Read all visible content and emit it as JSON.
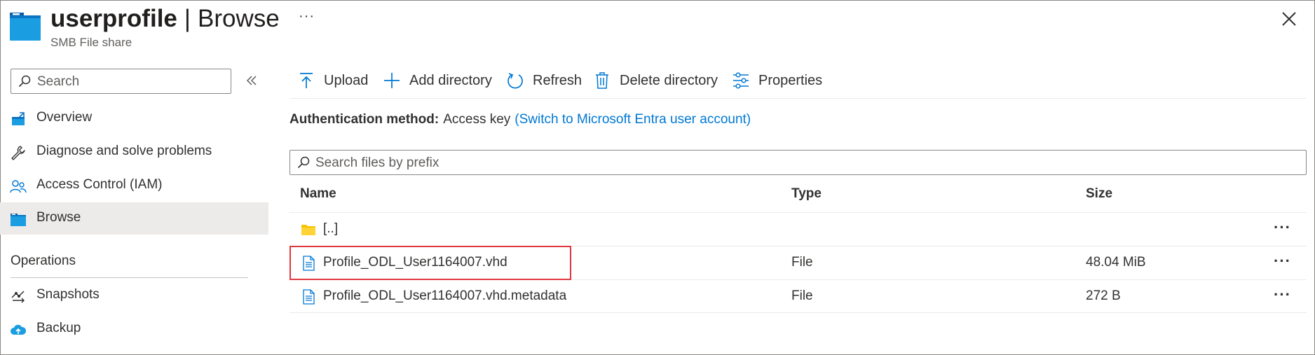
{
  "header": {
    "title_bold": "userprofile",
    "separator": "|",
    "title_rest": "Browse",
    "subtitle": "SMB File share",
    "more": "···",
    "icons": {
      "resource": "file-share-icon",
      "close": "close-icon"
    }
  },
  "sidebar": {
    "search_placeholder": "Search",
    "items": [
      {
        "label": "Overview",
        "icon": "overview-icon"
      },
      {
        "label": "Diagnose and solve problems",
        "icon": "wrench-icon"
      },
      {
        "label": "Access Control (IAM)",
        "icon": "people-icon"
      },
      {
        "label": "Browse",
        "icon": "file-share-icon",
        "active": true
      }
    ],
    "section": "Operations",
    "section_items": [
      {
        "label": "Snapshots",
        "icon": "snapshots-icon"
      },
      {
        "label": "Backup",
        "icon": "cloud-backup-icon"
      }
    ]
  },
  "toolbar": {
    "upload": "Upload",
    "add_directory": "Add directory",
    "refresh": "Refresh",
    "delete_directory": "Delete directory",
    "properties": "Properties"
  },
  "auth": {
    "label": "Authentication method:",
    "value": "Access key",
    "link": "(Switch to Microsoft Entra user account)"
  },
  "file_search": {
    "placeholder": "Search files by prefix"
  },
  "table": {
    "columns": {
      "name": "Name",
      "type": "Type",
      "size": "Size"
    },
    "rows": [
      {
        "name": "[..]",
        "type": "",
        "size": "",
        "icon": "folder-icon",
        "more": "···"
      },
      {
        "name": "Profile_ODL_User1164007.vhd",
        "type": "File",
        "size": "48.04 MiB",
        "icon": "file-icon",
        "more": "···",
        "highlighted": true
      },
      {
        "name": "Profile_ODL_User1164007.vhd.metadata",
        "type": "File",
        "size": "272 B",
        "icon": "file-icon",
        "more": "···"
      }
    ]
  },
  "colors": {
    "accent": "#0078d4",
    "highlight": "#e0383e",
    "active_bg": "#edebe9",
    "folder": "#f8c300"
  }
}
